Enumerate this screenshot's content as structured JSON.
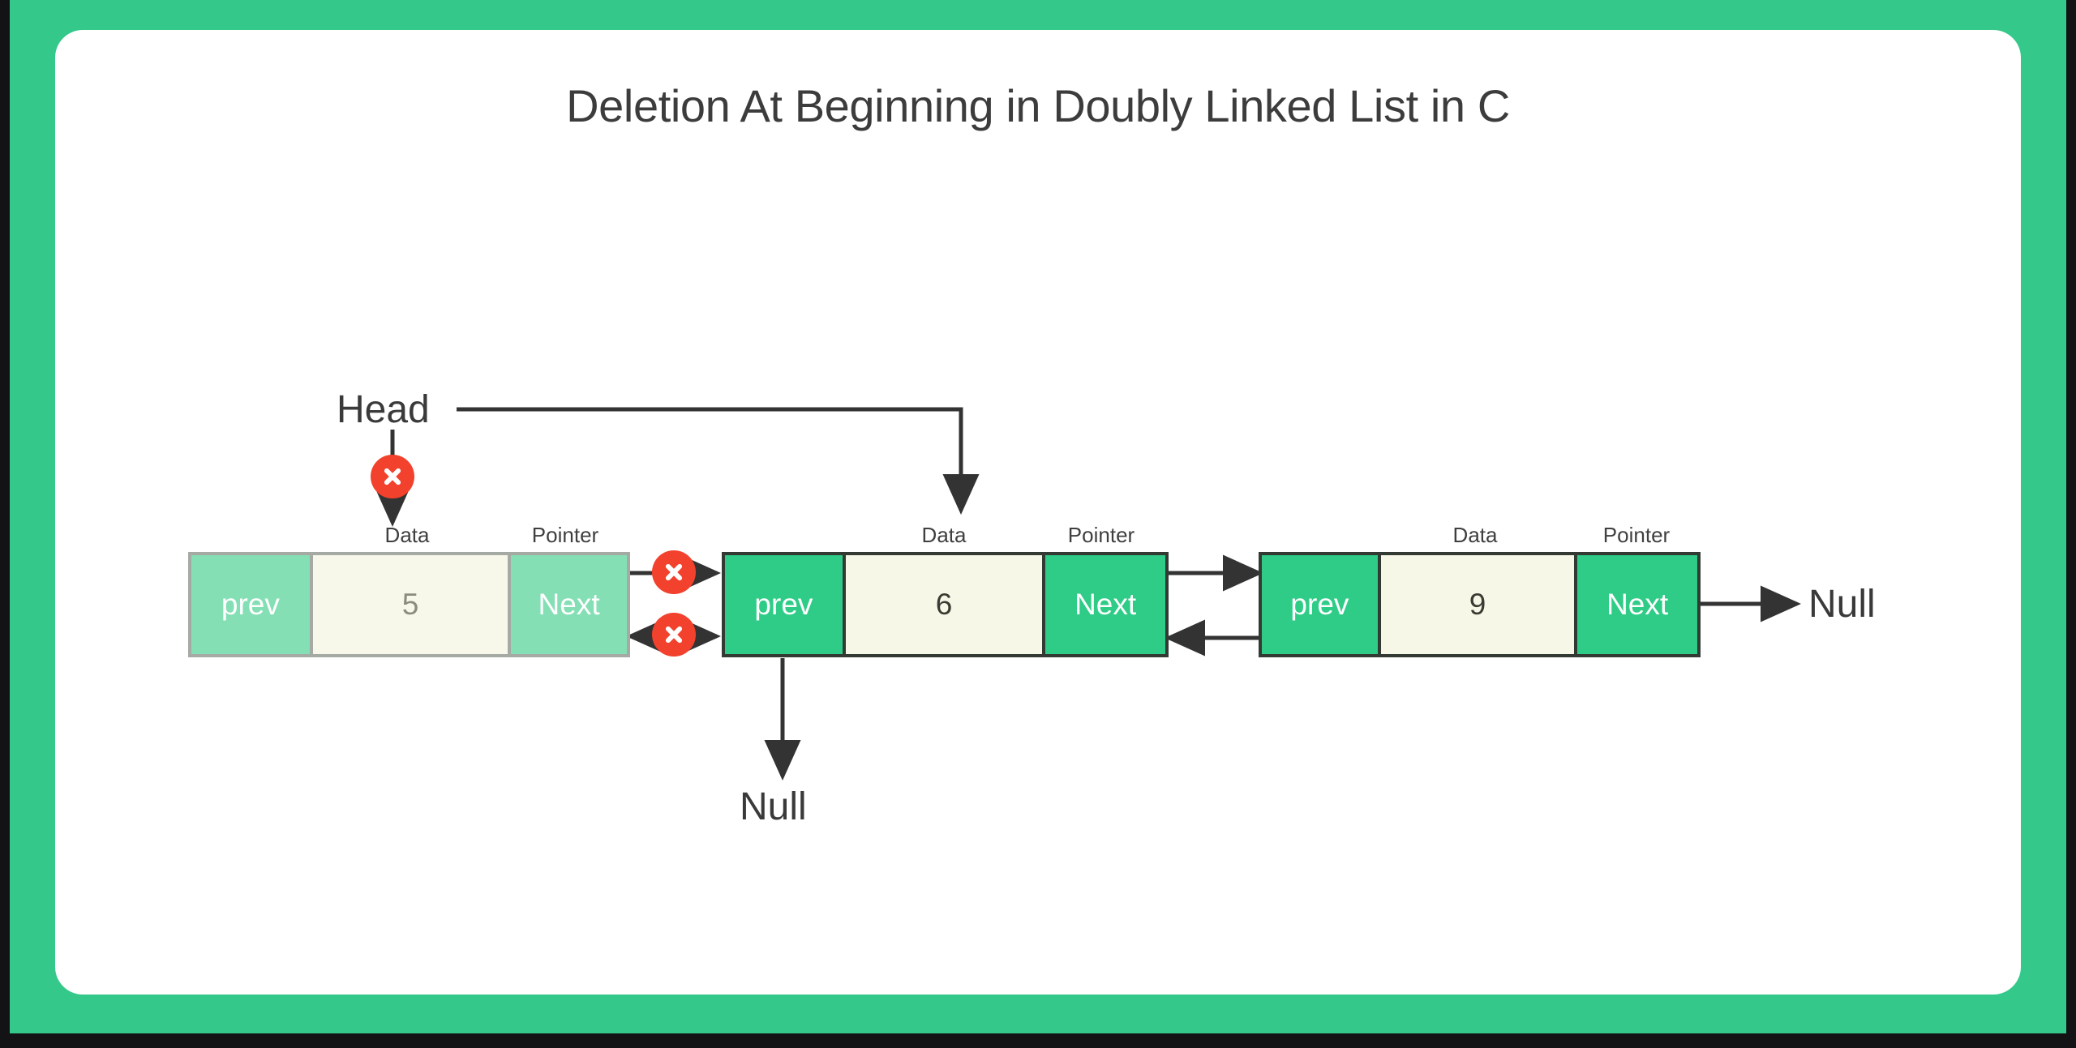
{
  "page": {
    "title": "Deletion At Beginning in Doubly Linked List in C",
    "frame_color": "#34c98a",
    "card_color": "#ffffff",
    "bezel_color": "#131316"
  },
  "palette": {
    "node_green": "#2ecc87",
    "node_green_faded": "#84dfb4",
    "data_cream": "#f7f7e8",
    "border_dark": "#333a33",
    "border_faded": "#a5aaa5",
    "delete_red": "#f2412c",
    "text_dark": "#3a3a3a",
    "text_faded": "#8a8d7c",
    "arrow_color": "#333333"
  },
  "diagram": {
    "type": "doubly-linked-list",
    "operation": "delete-at-beginning",
    "captions": {
      "data": "Data",
      "pointer": "Pointer"
    },
    "nodes": [
      {
        "id": "node-1",
        "state": "deleted",
        "prev_label": "prev",
        "data_value": "5",
        "next_label": "Next",
        "data_caption": "Data",
        "pointer_caption": "Pointer"
      },
      {
        "id": "node-2",
        "state": "active",
        "prev_label": "prev",
        "data_value": "6",
        "next_label": "Next",
        "data_caption": "Data",
        "pointer_caption": "Pointer"
      },
      {
        "id": "node-3",
        "state": "active",
        "prev_label": "prev",
        "data_value": "9",
        "next_label": "Next",
        "data_caption": "Data",
        "pointer_caption": "Pointer"
      }
    ],
    "labels": {
      "head": "Head",
      "null_tail": "Null",
      "null_head_prev": "Null"
    },
    "delete_markers": [
      {
        "id": "x-head-pointer",
        "note": "head pointer to node 1 removed"
      },
      {
        "id": "x-next-1-to-2",
        "note": "node 1 next link removed"
      },
      {
        "id": "x-prev-2-to-1",
        "note": "node 2 prev link removed"
      }
    ]
  }
}
